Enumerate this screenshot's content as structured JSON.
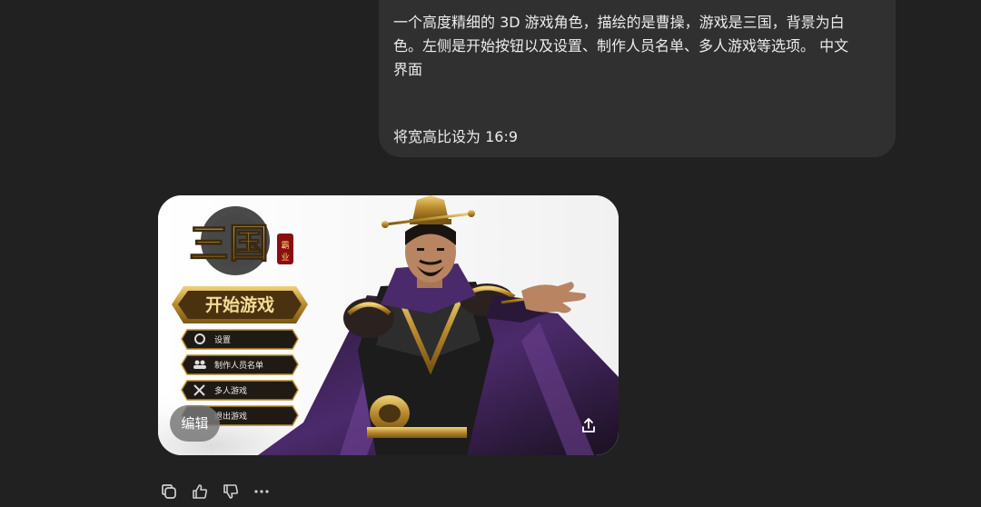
{
  "user_message": {
    "line1": "一个高度精细的 3D 游戏角色，描绘的是曹操，游戏是三国，背景为白",
    "line2": "色。左侧是开始按钮以及设置、制作人员名单、多人游戏等选项。 中文",
    "line3": "界面",
    "line4": "将宽高比设为 16:9"
  },
  "generated_image": {
    "logo_title": "三国",
    "logo_seal": "霸业",
    "start_button": "开始游戏",
    "menu_items": [
      {
        "label": "设置",
        "icon": "gear-icon"
      },
      {
        "label": "制作人员名单",
        "icon": "people-icon"
      },
      {
        "label": "多人游戏",
        "icon": "crossed-swords-icon"
      },
      {
        "label": "退出游戏",
        "icon": "exit-icon"
      }
    ],
    "edit_label": "编辑",
    "share_icon": "share-icon"
  },
  "actions": {
    "copy": "copy-icon",
    "like": "thumbs-up-icon",
    "dislike": "thumbs-down-icon",
    "more": "more-icon"
  },
  "colors": {
    "background": "#212121",
    "bubble": "#303030",
    "text": "#ececec",
    "gold": "#c9a34a",
    "purple": "#4b2a6b"
  }
}
